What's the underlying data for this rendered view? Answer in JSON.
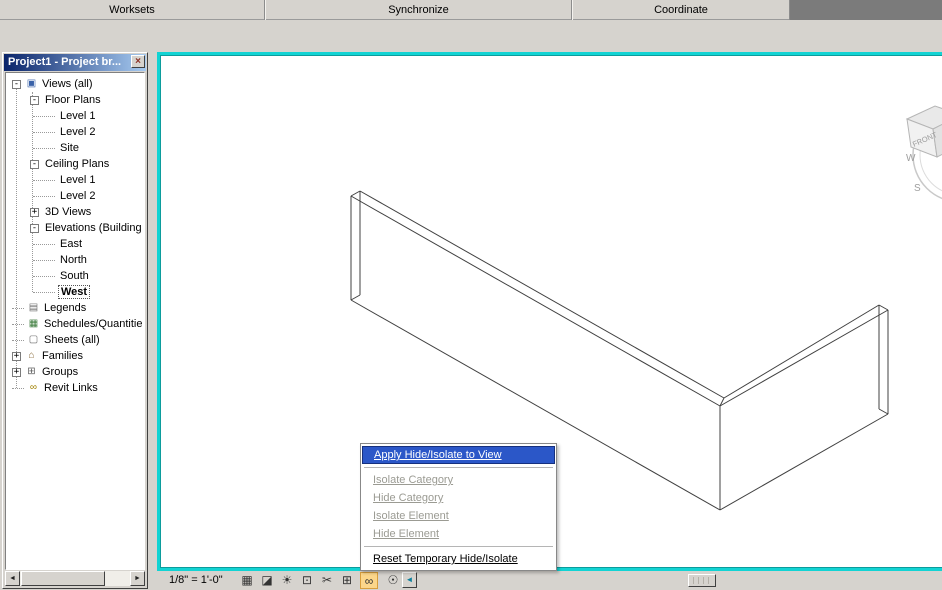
{
  "topbar": {
    "groups": [
      {
        "label": "Worksets"
      },
      {
        "label": "Synchronize"
      },
      {
        "label": "Coordinate"
      }
    ]
  },
  "browser": {
    "title": "Project1 - Project br...",
    "close_glyph": "×",
    "tree": [
      {
        "label": "Views (all)",
        "exp": "-",
        "icon": "views"
      },
      {
        "label": "Floor Plans",
        "exp": "-"
      },
      {
        "label": "Level 1"
      },
      {
        "label": "Level 2"
      },
      {
        "label": "Site"
      },
      {
        "label": "Ceiling Plans",
        "exp": "-"
      },
      {
        "label": "Level 1"
      },
      {
        "label": "Level 2"
      },
      {
        "label": "3D Views",
        "exp": "+"
      },
      {
        "label": "Elevations (Building",
        "exp": "-"
      },
      {
        "label": "East"
      },
      {
        "label": "North"
      },
      {
        "label": "South"
      },
      {
        "label": "West",
        "selected": true
      },
      {
        "label": "Legends",
        "icon": "legends"
      },
      {
        "label": "Schedules/Quantitie",
        "icon": "schedules"
      },
      {
        "label": "Sheets (all)",
        "icon": "sheets"
      },
      {
        "label": "Families",
        "exp": "+",
        "icon": "families"
      },
      {
        "label": "Groups",
        "exp": "+",
        "icon": "groups"
      },
      {
        "label": "Revit Links",
        "icon": "links"
      }
    ],
    "scroll": {
      "left": "◄",
      "right": "►"
    }
  },
  "icon_glyphs": {
    "views": "▣",
    "legends": "▤",
    "schedules": "▦",
    "sheets": "▢",
    "families": "⌂",
    "groups": "⊞",
    "links": "∞"
  },
  "viewbar": {
    "scale": "1/8\" = 1'-0\"",
    "icons": [
      {
        "name": "detail-level",
        "glyph": "▦"
      },
      {
        "name": "model-graphics-style",
        "glyph": "◪"
      },
      {
        "name": "shadows-toggle",
        "glyph": "☀"
      },
      {
        "name": "render-dialog",
        "glyph": "⊡"
      },
      {
        "name": "crop-view",
        "glyph": "✂"
      },
      {
        "name": "crop-region-visibility",
        "glyph": "⊞"
      },
      {
        "name": "temporary-hide-isolate",
        "glyph": "∞"
      },
      {
        "name": "reveal-hidden-elements",
        "glyph": "☉"
      }
    ],
    "collapse_glyph": "◄"
  },
  "menu": {
    "items": [
      {
        "label": "Apply Hide/Isolate to View",
        "state": "highlighted"
      },
      {
        "label": "Isolate Category",
        "state": "disabled"
      },
      {
        "label": "Hide Category",
        "state": "disabled"
      },
      {
        "label": "Isolate Element",
        "state": "disabled"
      },
      {
        "label": "Hide Element",
        "state": "disabled"
      },
      {
        "label": "Reset Temporary Hide/Isolate",
        "state": "normal"
      }
    ]
  },
  "viewcube": {
    "front": "FRONT",
    "west": "W",
    "south": "S"
  },
  "colors": {
    "selection_blue": "#2b57c8",
    "canvas_border": "#12d3d3",
    "menu_highlight": "#2b57c8"
  }
}
